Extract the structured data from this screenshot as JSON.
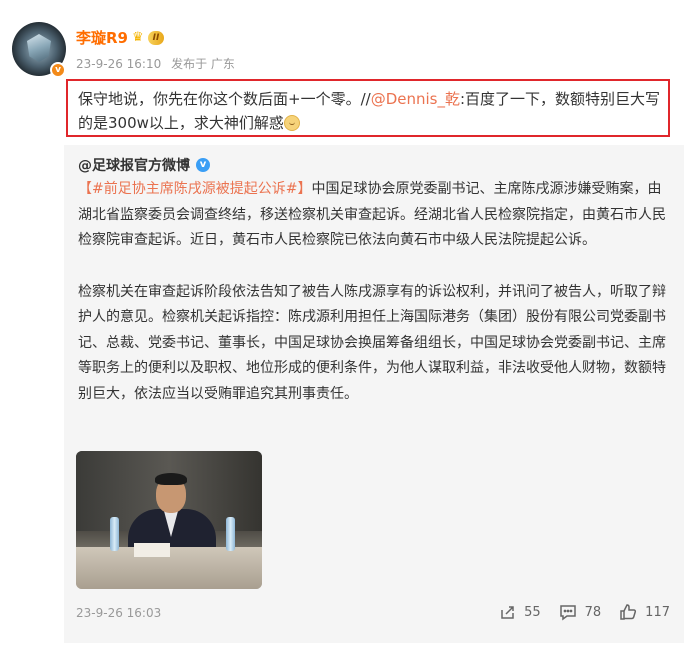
{
  "post": {
    "username": "李璇R9",
    "level_badge": "II",
    "time": "23-9-26 16:10",
    "source": "发布于 广东",
    "comment_prefix": "保守地说，你先在你这个数后面+一个零。//",
    "comment_mention": "@Dennis_乾",
    "comment_suffix": ":百度了一下，数额特别巨大写的是300w以上，求大神们解惑"
  },
  "repost": {
    "source_name": "@足球报官方微博",
    "hashtag": "【#前足协主席陈戌源被提起公诉#】",
    "paragraph1": "中国足球协会原党委副书记、主席陈戌源涉嫌受贿案，由湖北省监察委员会调查终结，移送检察机关审查起诉。经湖北省人民检察院指定，由黄石市人民检察院审查起诉。近日，黄石市人民检察院已依法向黄石市中级人民法院提起公诉。",
    "paragraph2": "检察机关在审查起诉阶段依法告知了被告人陈戌源享有的诉讼权利，并讯问了被告人，听取了辩护人的意见。检察机关起诉指控：陈戌源利用担任上海国际港务（集团）股份有限公司党委副书记、总裁、党委书记、董事长，中国足球协会换届筹备组组长，中国足球协会党委副书记、主席等职务上的便利以及职权、地位形成的便利条件，为他人谋取利益，非法收受他人财物，数额特别巨大，依法应当以受贿罪追究其刑事责任。",
    "time": "23-9-26 16:03",
    "shares": "55",
    "comments": "78",
    "likes": "117"
  },
  "colors": {
    "username": "#ff6d00",
    "highlight_border": "#e0262b",
    "link": "#eb7350",
    "repost_bg": "#f5f5f5"
  },
  "icons": {
    "share": "share-icon",
    "comment": "comment-icon",
    "like": "like-icon",
    "verified": "verified-icon",
    "crown": "crown-icon"
  }
}
